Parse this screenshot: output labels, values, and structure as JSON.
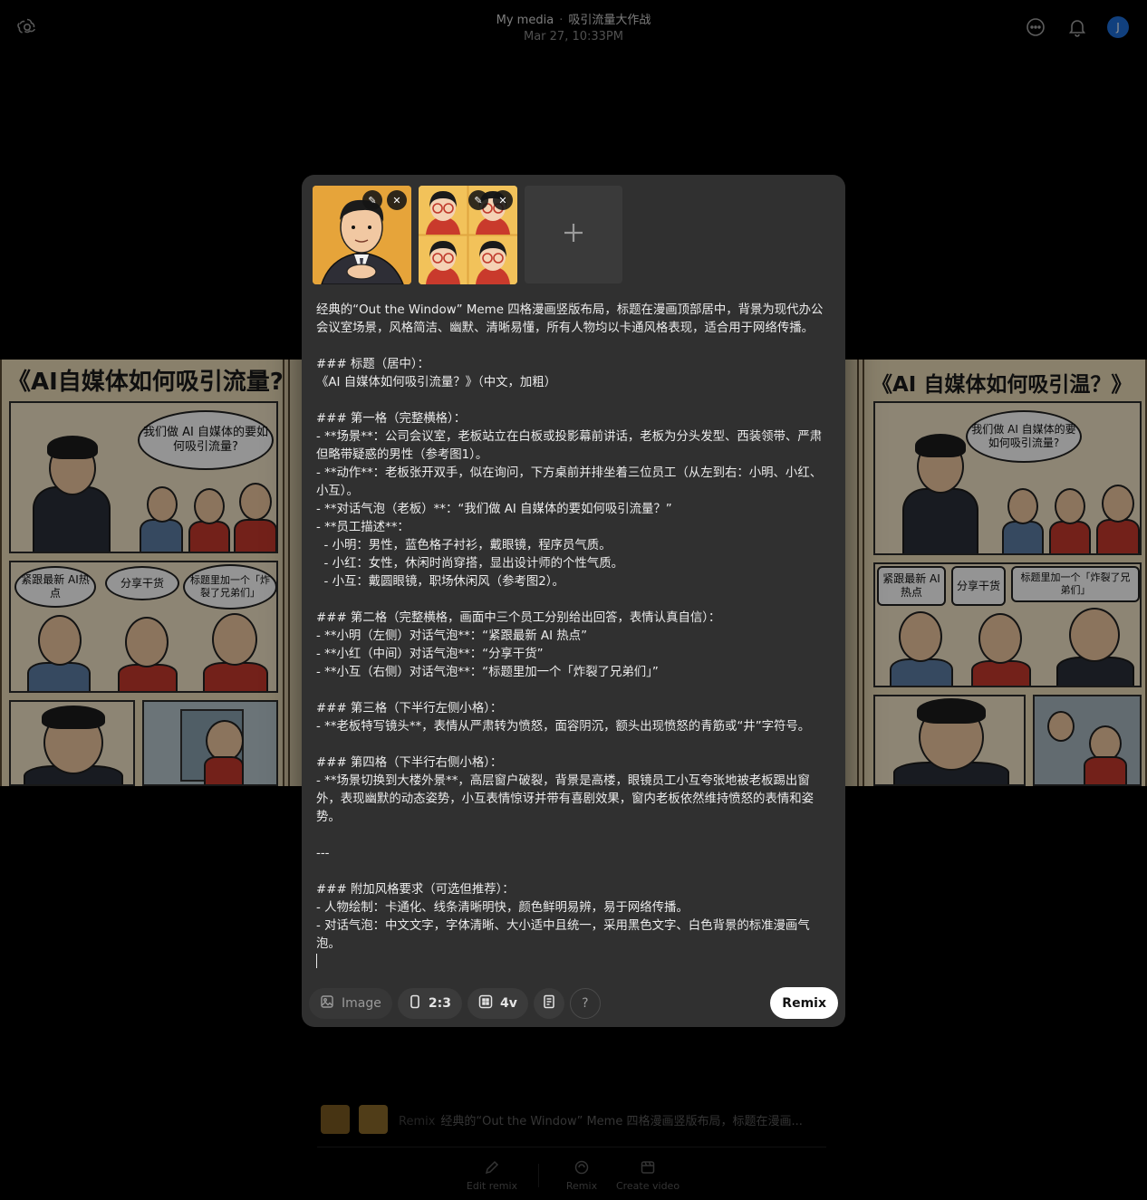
{
  "header": {
    "breadcrumb_root": "My media",
    "breadcrumb_separator": "·",
    "project_title": "吸引流量大作战",
    "timestamp": "Mar 27, 10:33PM",
    "avatar_initial": "J"
  },
  "comic": {
    "left_title": "《AI自媒体如何吸引流量?",
    "right_title": "《AI 自媒体如何吸引温？》",
    "left_bubble_boss": "我们做 AI 自媒体的要如何吸引流量?",
    "left_bubble_1": "紧跟最新 AI热点",
    "left_bubble_2": "分享干货",
    "left_bubble_3": "标题里加一个「炸裂了兄弟们」",
    "right_bubble_boss": "我们做 AI 自媒体的要如何吸引流量?",
    "right_bubble_1": "紧跟最新 AI热点",
    "right_bubble_2": "分享干货",
    "right_bubble_3": "标题里加一个「炸裂了兄弟们」"
  },
  "composer": {
    "attachments": [
      {
        "name": "boss-reference"
      },
      {
        "name": "employee-grid-reference"
      }
    ],
    "prompt_text": "经典的“Out the Window” Meme 四格漫画竖版布局，标题在漫画顶部居中，背景为现代办公会议室场景，风格简洁、幽默、清晰易懂，所有人物均以卡通风格表现，适合用于网络传播。\n\n### 标题（居中）：\n《AI 自媒体如何吸引流量？》（中文，加粗）\n\n### 第一格（完整横格）：\n- **场景**：公司会议室，老板站立在白板或投影幕前讲话，老板为分头发型、西装领带、严肃但略带疑惑的男性（参考图1）。\n- **动作**：老板张开双手，似在询问，下方桌前并排坐着三位员工（从左到右：小明、小红、小互）。\n- **对话气泡（老板）**：“我们做 AI 自媒体的要如何吸引流量？”\n- **员工描述**：\n  - 小明：男性，蓝色格子衬衫，戴眼镜，程序员气质。\n  - 小红：女性，休闲时尚穿搭，显出设计师的个性气质。\n  - 小互：戴圆眼镜，职场休闲风（参考图2）。\n\n### 第二格（完整横格，画面中三个员工分别给出回答，表情认真自信）：\n- **小明（左侧）对话气泡**：“紧跟最新 AI 热点”\n- **小红（中间）对话气泡**：“分享干货”\n- **小互（右侧）对话气泡**：“标题里加一个「炸裂了兄弟们」”\n\n### 第三格（下半行左侧小格）：\n- **老板特写镜头**，表情从严肃转为愤怒，面容阴沉，额头出现愤怒的青筋或“井”字符号。\n\n### 第四格（下半行右侧小格）：\n- **场景切换到大楼外景**，高层窗户破裂，背景是高楼，眼镜员工小互夸张地被老板踢出窗外，表现幽默的动态姿势，小互表情惊讶并带有喜剧效果，窗内老板依然维持愤怒的表情和姿势。\n\n---\n\n### 附加风格要求（可选但推荐）：\n- 人物绘制：卡通化、线条清晰明快，颜色鲜明易辨，易于网络传播。\n- 对话气泡：中文文字，字体清晰、大小适中且统一，采用黑色文字、白色背景的标准漫画气泡。\n",
    "toolbar": {
      "image_label": "Image",
      "aspect_label": "2:3",
      "variations_label": "4v",
      "help_label": "?",
      "submit_label": "Remix"
    }
  },
  "history": {
    "tag": "Remix",
    "snippet": "经典的“Out the Window” Meme 四格漫画竖版布局，标题在漫画..."
  },
  "actions": {
    "edit_label": "Edit remix",
    "remix_label": "Remix",
    "video_label": "Create video"
  },
  "colors": {
    "background": "#000000",
    "modal": "#303030",
    "pill": "#3b3b3b",
    "submit_button": "#ffffff",
    "avatar": "#1e6fd9"
  }
}
